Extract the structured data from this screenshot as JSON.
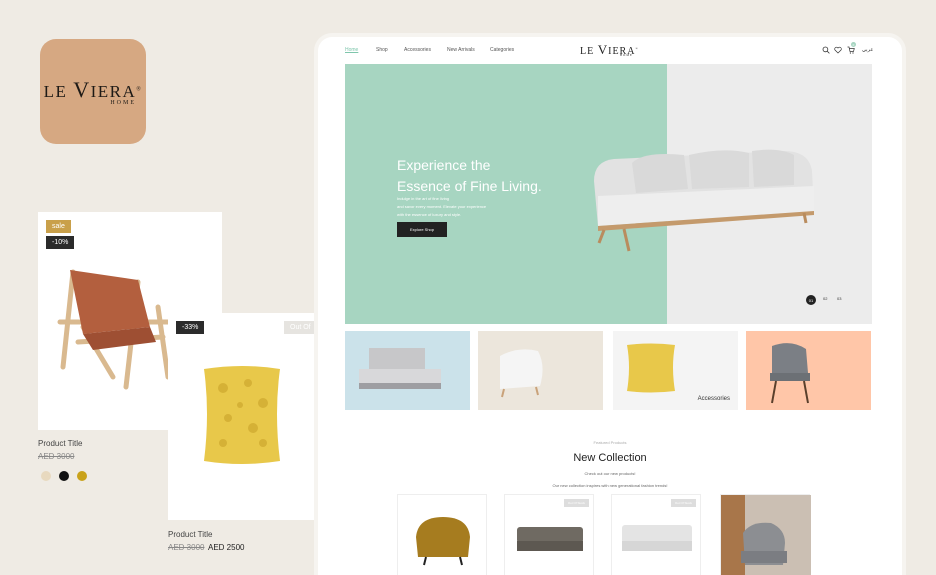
{
  "logo": {
    "word_le": "LE ",
    "word_v": "V",
    "word_rest": "IERA",
    "mark": "®",
    "sub": "HOME"
  },
  "product1": {
    "badge_sale": "sale",
    "badge_discount": "-10%",
    "title": "Product Title",
    "old_price": "AED 3000",
    "swatches": [
      "#e8d9bf",
      "#111111",
      "#c9a21a"
    ]
  },
  "product2": {
    "badge_discount": "-33%",
    "badge_stock": "Out Of",
    "title": "Product Title",
    "old_price": "AED 3000",
    "new_price": "AED 2500"
  },
  "site": {
    "nav": [
      "Home",
      "Shop",
      "Accessories",
      "New Arrivals",
      "Categories"
    ],
    "brand_le": "LE ",
    "brand_v": "V",
    "brand_rest": "IERA",
    "brand_mark": "®",
    "brand_sub": "HOME",
    "cart_count": "0",
    "language": "عربي",
    "hero": {
      "title_line1": "Experience the",
      "title_line2": "Essence of Fine Living.",
      "subtitle_line1": "Indulge in the art of fine living",
      "subtitle_line2": "and savor every moment. Elevate your experience",
      "subtitle_line3": "with the essence of luxury and style.",
      "button": "Explore Shop",
      "dots": [
        "01",
        "02",
        "03"
      ]
    },
    "categories": [
      {
        "name": "bed"
      },
      {
        "name": "armchair"
      },
      {
        "name": "accessories",
        "label": "Accessories"
      },
      {
        "name": "chair"
      }
    ],
    "featured": {
      "label": "Featured Products",
      "title": "New Collection",
      "sub1": "Check out our new products!",
      "sub2": "Our new collection inspires with new generational fashion trends!",
      "badges": [
        "Out Of Stock",
        "Out Of Stock"
      ]
    }
  },
  "colors": {
    "accent_mint": "#a7d5c1",
    "peach": "#ffc6a8",
    "sky": "#cbe2ea",
    "beige": "#efebe4",
    "gold": "#c9a04a"
  }
}
